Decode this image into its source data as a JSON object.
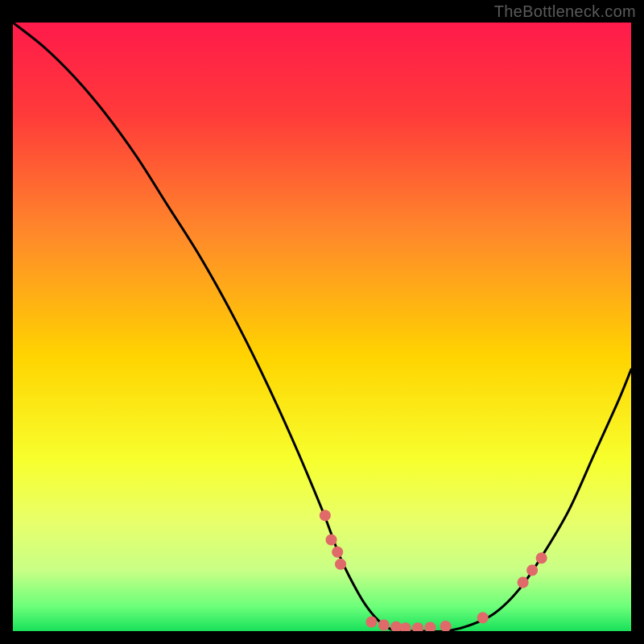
{
  "watermark": "TheBottleneck.com",
  "chart_data": {
    "type": "line",
    "title": "",
    "xlabel": "",
    "ylabel": "",
    "xlim": [
      0,
      100
    ],
    "ylim": [
      0,
      100
    ],
    "grid": false,
    "legend": false,
    "background_gradient": {
      "stops": [
        {
          "pos": 0.0,
          "color": "#ff1a4b"
        },
        {
          "pos": 0.15,
          "color": "#ff3a3a"
        },
        {
          "pos": 0.35,
          "color": "#ff8a2a"
        },
        {
          "pos": 0.55,
          "color": "#ffd400"
        },
        {
          "pos": 0.72,
          "color": "#f7ff2e"
        },
        {
          "pos": 0.82,
          "color": "#e8ff6a"
        },
        {
          "pos": 0.9,
          "color": "#c8ff86"
        },
        {
          "pos": 0.96,
          "color": "#6bff7a"
        },
        {
          "pos": 1.0,
          "color": "#18e05a"
        }
      ]
    },
    "series": [
      {
        "name": "bottleneck-curve",
        "color": "#000000",
        "x": [
          0,
          5,
          10,
          15,
          20,
          25,
          30,
          35,
          40,
          45,
          50,
          53,
          56,
          58,
          60,
          62,
          64,
          66,
          70,
          74,
          78,
          82,
          86,
          90,
          94,
          98,
          100
        ],
        "y": [
          100,
          96,
          91,
          85,
          78,
          70,
          62,
          53,
          43,
          32,
          20,
          12,
          6,
          3,
          1,
          0,
          0,
          0,
          0,
          1,
          3,
          7,
          13,
          20,
          29,
          38,
          43
        ]
      }
    ],
    "markers": {
      "name": "highlighted-points",
      "color": "#e06a6a",
      "radius_px": 7,
      "points": [
        {
          "x": 50.5,
          "y": 19
        },
        {
          "x": 51.5,
          "y": 15
        },
        {
          "x": 52.5,
          "y": 13
        },
        {
          "x": 53.0,
          "y": 11
        },
        {
          "x": 58.0,
          "y": 1.5
        },
        {
          "x": 60.0,
          "y": 1.0
        },
        {
          "x": 62.0,
          "y": 0.7
        },
        {
          "x": 63.5,
          "y": 0.5
        },
        {
          "x": 65.5,
          "y": 0.5
        },
        {
          "x": 67.5,
          "y": 0.6
        },
        {
          "x": 70.0,
          "y": 0.8
        },
        {
          "x": 76.0,
          "y": 2.2
        },
        {
          "x": 82.5,
          "y": 8.0
        },
        {
          "x": 84.0,
          "y": 10.0
        },
        {
          "x": 85.5,
          "y": 12.0
        }
      ]
    }
  }
}
